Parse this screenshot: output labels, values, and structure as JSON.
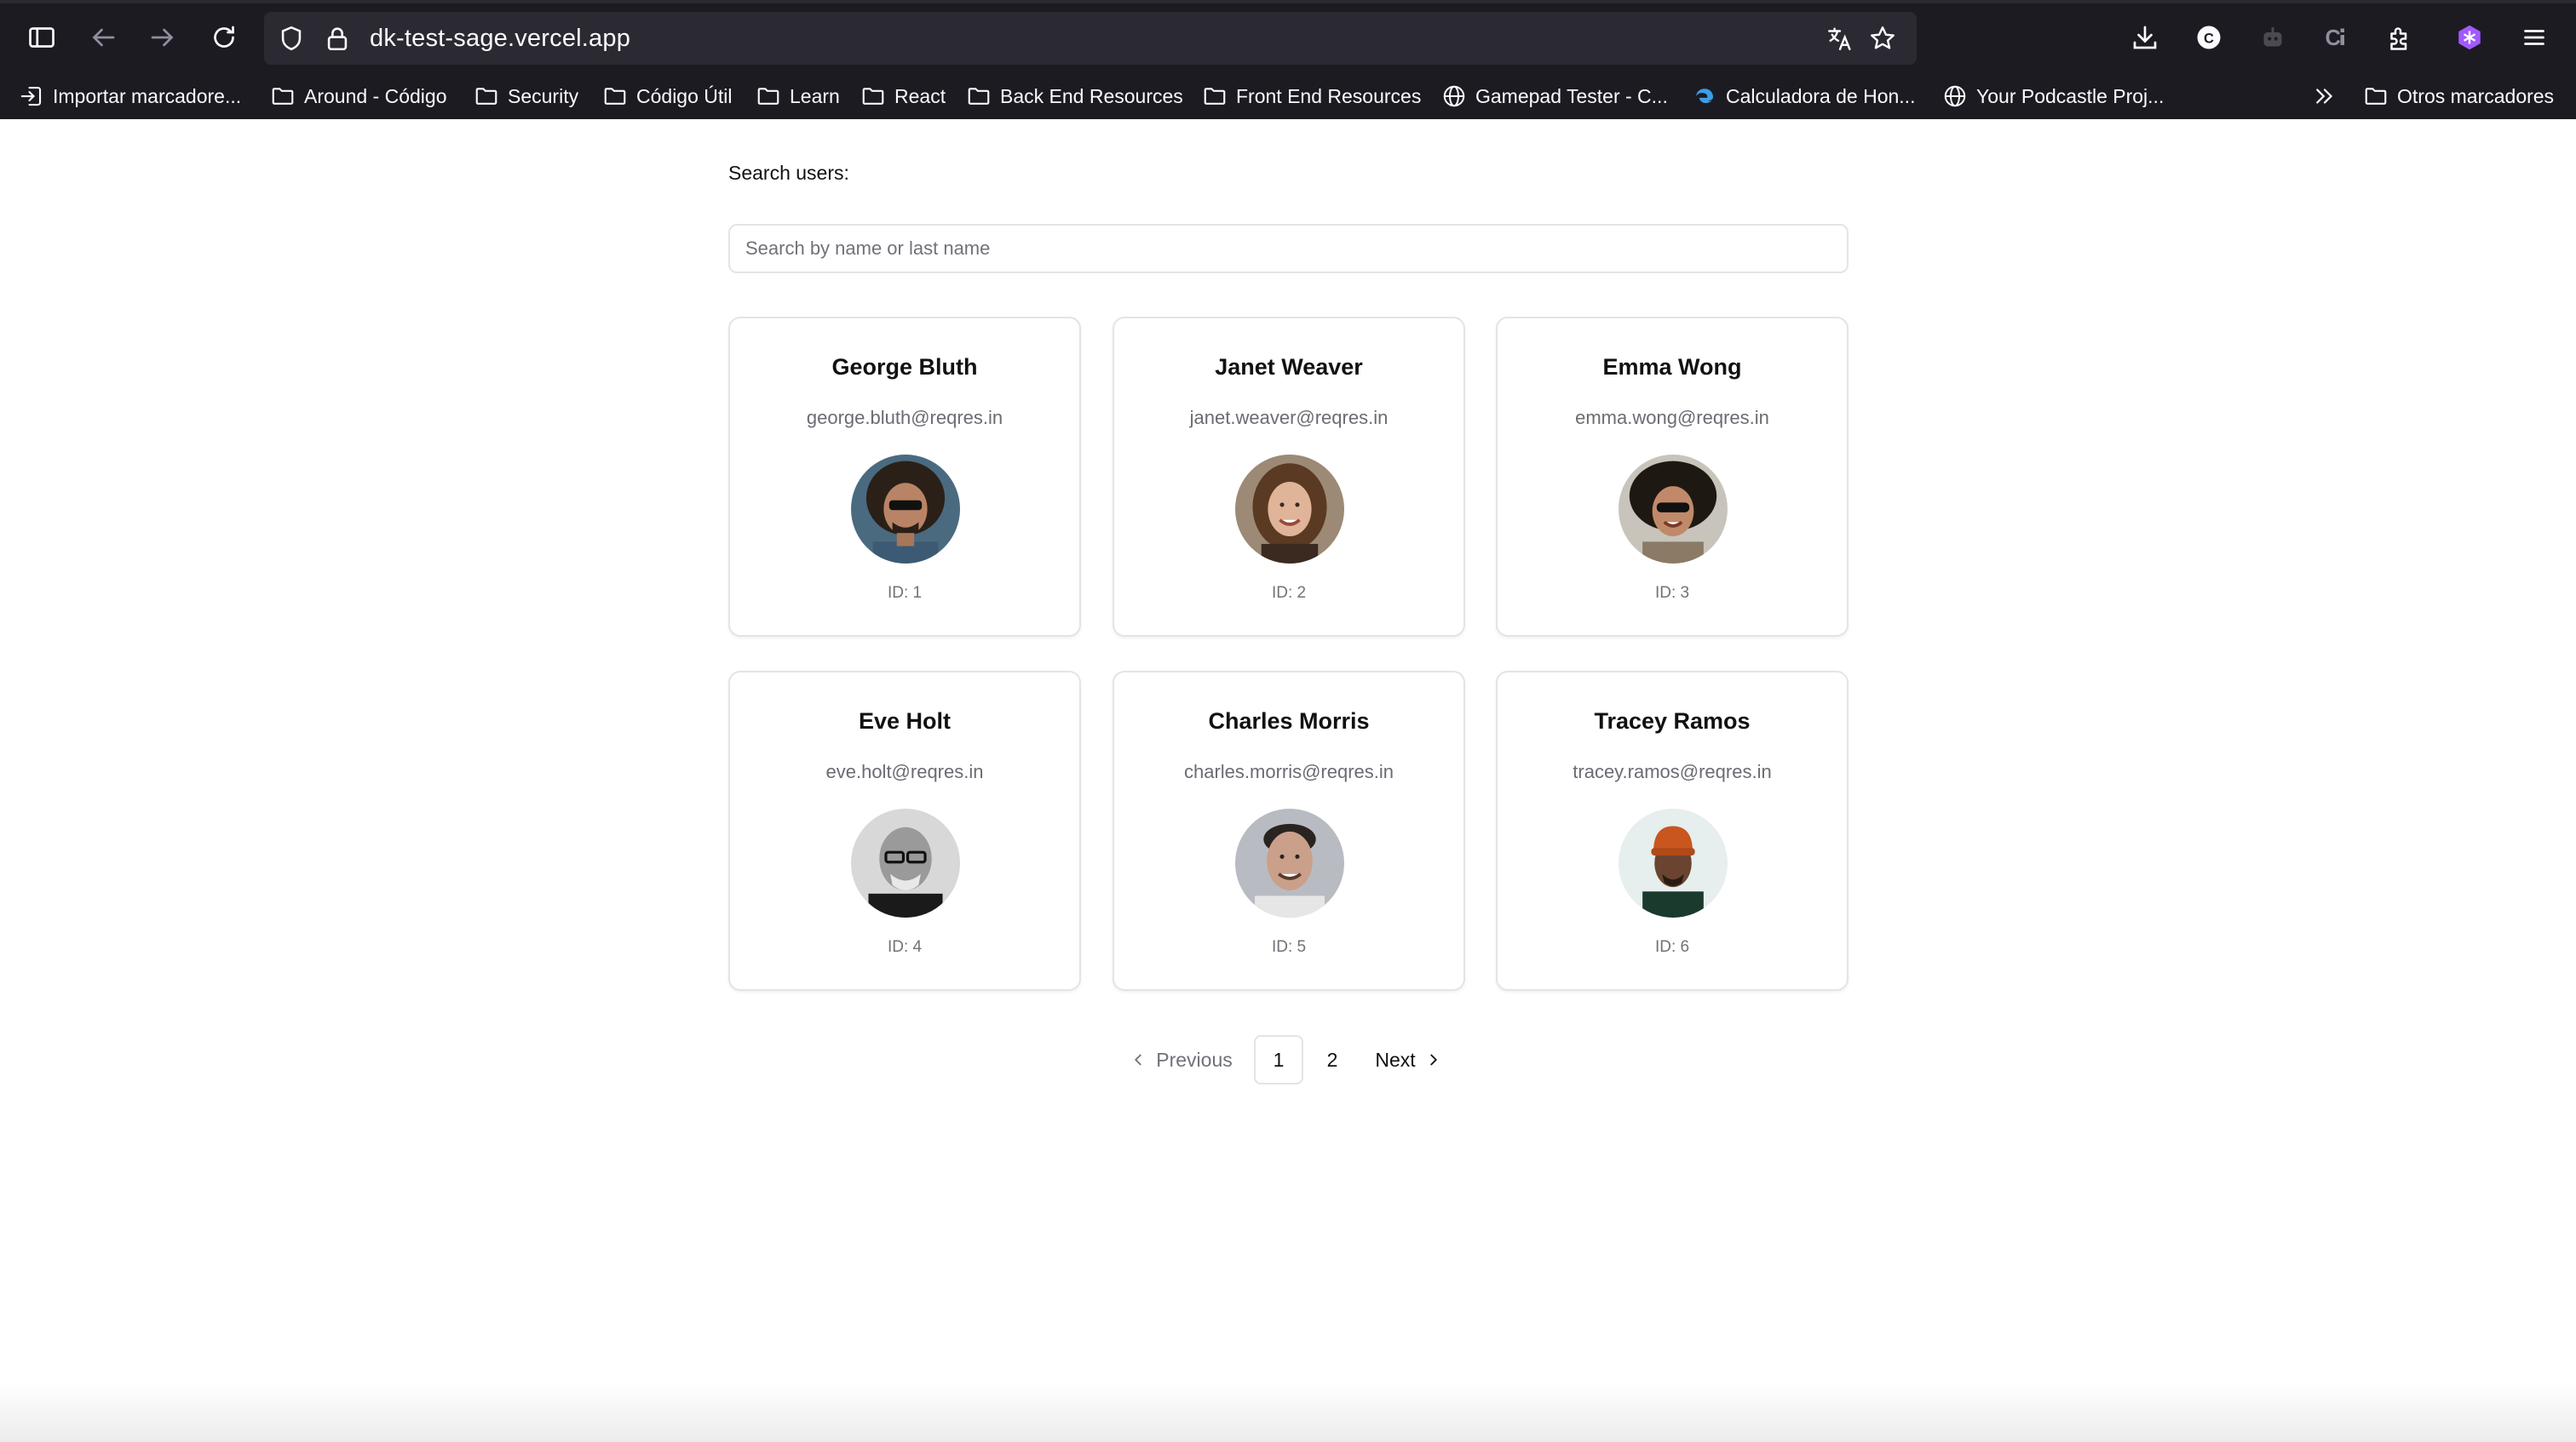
{
  "browser": {
    "url": "dk-test-sage.vercel.app",
    "bookmarks": [
      {
        "label": "Importar marcadore...",
        "icon": "import-icon"
      },
      {
        "label": "Around - Código",
        "icon": "folder-icon"
      },
      {
        "label": "Security",
        "icon": "folder-icon"
      },
      {
        "label": "Código Útil",
        "icon": "folder-icon"
      },
      {
        "label": "Learn",
        "icon": "folder-icon"
      },
      {
        "label": "React",
        "icon": "folder-icon"
      },
      {
        "label": "Back End Resources",
        "icon": "folder-icon"
      },
      {
        "label": "Front End Resources",
        "icon": "folder-icon"
      },
      {
        "label": "Gamepad Tester - C...",
        "icon": "globe-icon"
      },
      {
        "label": "Calculadora de Hon...",
        "icon": "edge-icon"
      },
      {
        "label": "Your Podcastle Proj...",
        "icon": "globe-icon"
      }
    ],
    "other_bookmarks": "Otros marcadores"
  },
  "search": {
    "label": "Search users:",
    "placeholder": "Search by name or last name",
    "value": ""
  },
  "users": [
    {
      "name": "George Bluth",
      "email": "george.bluth@reqres.in",
      "id_label": "ID: 1"
    },
    {
      "name": "Janet Weaver",
      "email": "janet.weaver@reqres.in",
      "id_label": "ID: 2"
    },
    {
      "name": "Emma Wong",
      "email": "emma.wong@reqres.in",
      "id_label": "ID: 3"
    },
    {
      "name": "Eve Holt",
      "email": "eve.holt@reqres.in",
      "id_label": "ID: 4"
    },
    {
      "name": "Charles Morris",
      "email": "charles.morris@reqres.in",
      "id_label": "ID: 5"
    },
    {
      "name": "Tracey Ramos",
      "email": "tracey.ramos@reqres.in",
      "id_label": "ID: 6"
    }
  ],
  "pagination": {
    "previous": "Previous",
    "next": "Next",
    "pages": [
      "1",
      "2"
    ],
    "current": "1"
  },
  "colors": {
    "chrome_bg": "#1c1b22",
    "urlbar_bg": "#2b2a33",
    "card_border": "#e4e4e7",
    "muted_text": "#71717a",
    "extension_accent": "#a259ff"
  }
}
